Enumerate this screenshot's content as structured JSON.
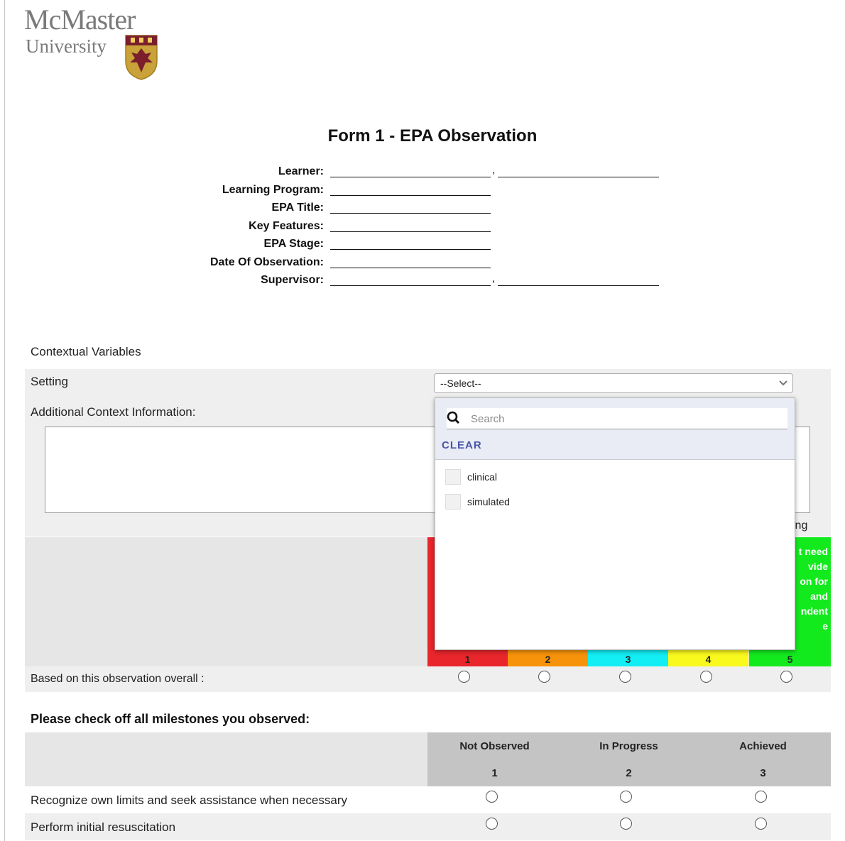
{
  "logo": {
    "line1": "McMaster",
    "line2": "University"
  },
  "form": {
    "title": "Form 1 - EPA Observation",
    "fields": [
      {
        "label": "Learner:",
        "double": true
      },
      {
        "label": "Learning Program:",
        "double": false
      },
      {
        "label": "EPA Title:",
        "double": false
      },
      {
        "label": "Key Features:",
        "double": false
      },
      {
        "label": "EPA Stage:",
        "double": false
      },
      {
        "label": "Date Of Observation:",
        "double": false
      },
      {
        "label": "Supervisor:",
        "double": true
      }
    ],
    "comma": ","
  },
  "contextual": {
    "heading": "Contextual Variables",
    "setting_label": "Setting",
    "setting_value": "--Select--",
    "additional_label": "Additional Context Information:",
    "partial_text_right": "ing"
  },
  "dropdown": {
    "search_placeholder": "Search",
    "clear_label": "CLEAR",
    "options": [
      "clinical",
      "simulated"
    ]
  },
  "scale": {
    "columns": [
      {
        "num": "1",
        "color": "#e8262b",
        "text": ""
      },
      {
        "num": "2",
        "color": "#f7930a",
        "text": ""
      },
      {
        "num": "3",
        "color": "#12eef4",
        "text": ""
      },
      {
        "num": "4",
        "color": "#f9f91e",
        "text": ""
      },
      {
        "num": "5",
        "color": "#13ea1e",
        "text": "t need\nvide\non for\nand\nndent\ne"
      }
    ],
    "overall_label": "Based on this observation overall :"
  },
  "milestones": {
    "heading": "Please check off all milestones you observed:",
    "columns": [
      {
        "label": "Not Observed",
        "num": "1"
      },
      {
        "label": "In Progress",
        "num": "2"
      },
      {
        "label": "Achieved",
        "num": "3"
      }
    ],
    "rows": [
      "Recognize own limits and seek assistance when necessary",
      "Perform initial resuscitation"
    ]
  }
}
